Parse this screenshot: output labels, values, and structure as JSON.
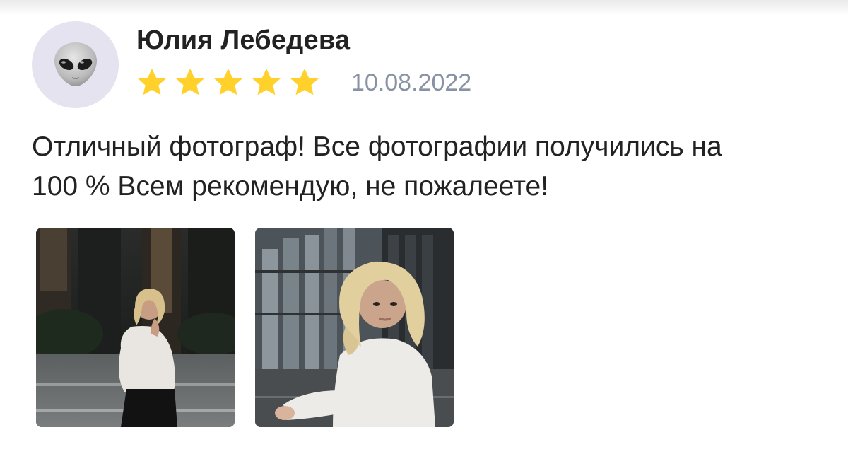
{
  "review": {
    "author_name": "Юлия Лебедева",
    "rating": 5,
    "max_rating": 5,
    "date": "10.08.2022",
    "text_line1": "Отличный фотограф! Все фотографии получились на",
    "text_line2": "100 % Всем рекомендую, не пожалеете!",
    "avatar_icon": "alien-emoji-icon",
    "star_icon": "star-icon",
    "star_color": "#ffd12a",
    "photos_count": 2
  }
}
